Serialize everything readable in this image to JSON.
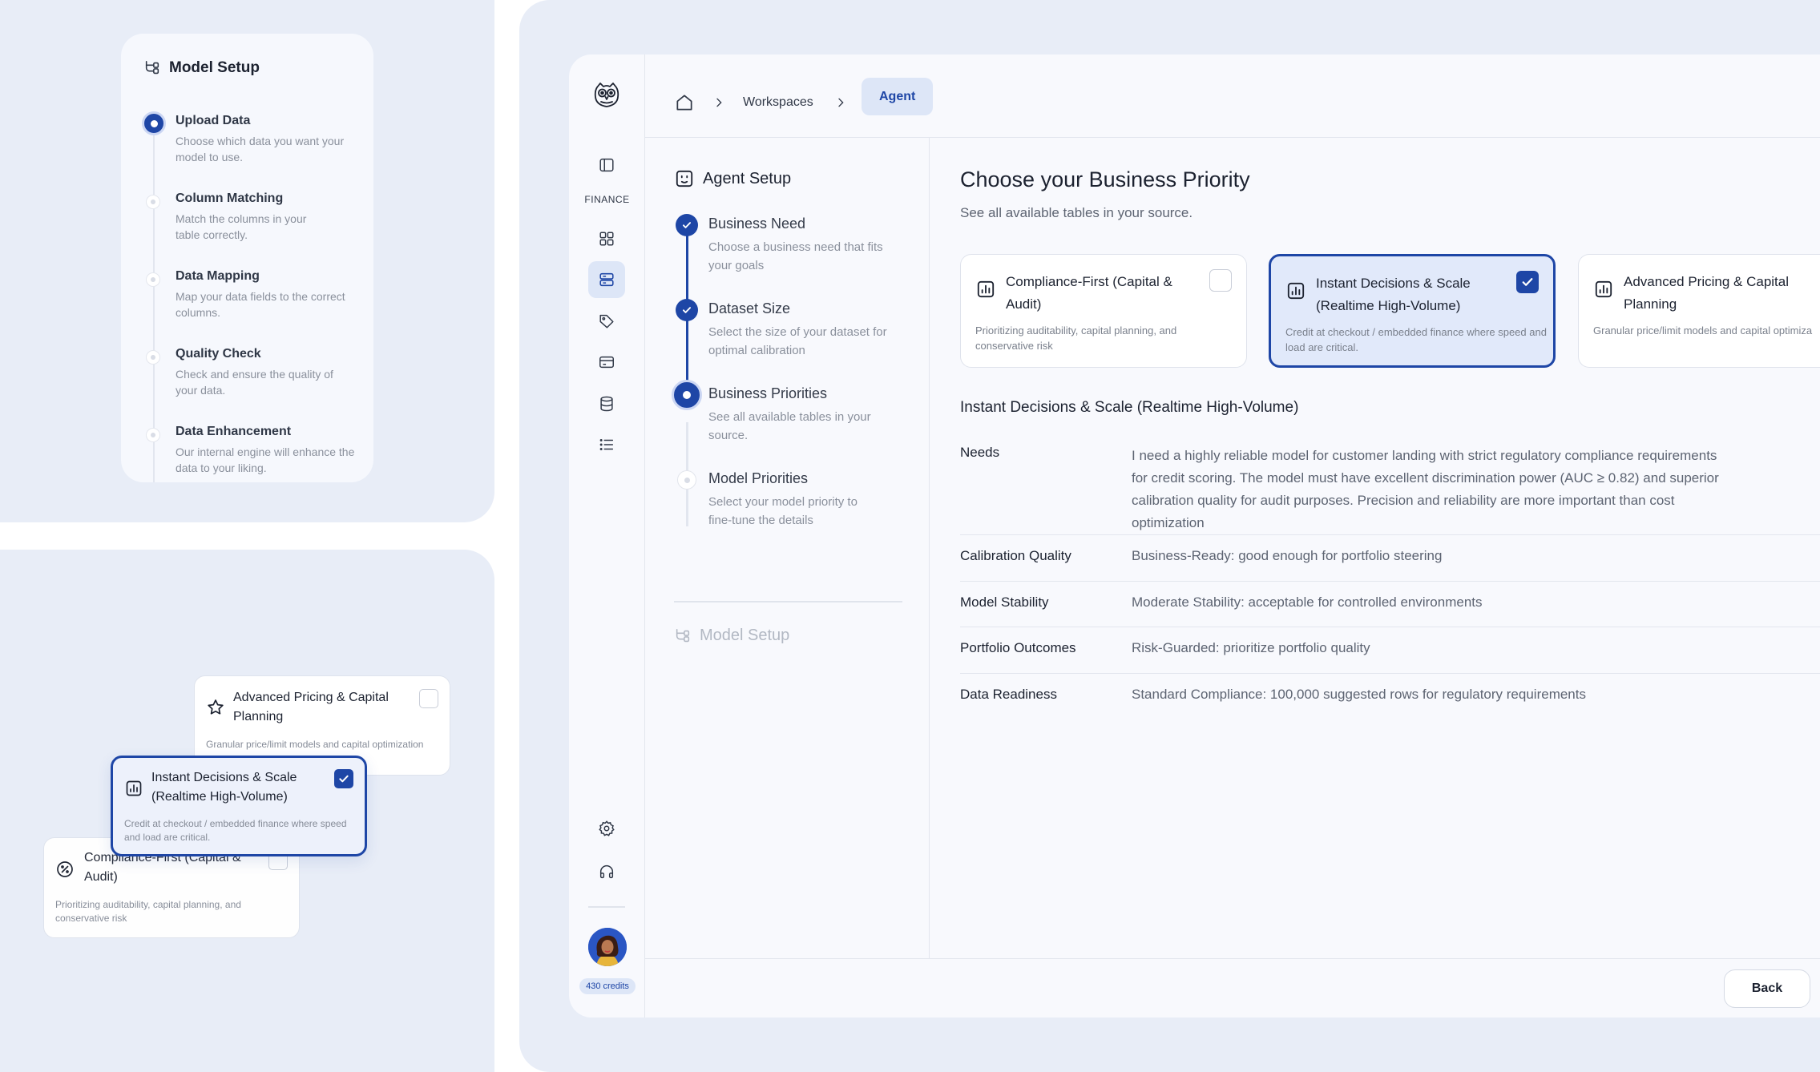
{
  "model_setup_card": {
    "title": "Model Setup",
    "steps": [
      {
        "title": "Upload Data",
        "desc": "Choose which data you want your model to use.",
        "state": "active"
      },
      {
        "title": "Column Matching",
        "desc": "Match the columns in your table correctly.",
        "state": "pending"
      },
      {
        "title": "Data Mapping",
        "desc": "Map your data fields to the correct columns.",
        "state": "pending"
      },
      {
        "title": "Quality Check",
        "desc": "Check and ensure the quality of your data.",
        "state": "pending"
      },
      {
        "title": "Data Enhancement",
        "desc": "Our internal engine will enhance the data to your liking.",
        "state": "pending"
      }
    ]
  },
  "stacked_cards": {
    "advanced": {
      "title": "Advanced Pricing & Capital Planning",
      "desc": "Granular price/limit models and capital optimization",
      "icon": "star-icon",
      "checked": false
    },
    "instant": {
      "title": "Instant Decisions & Scale (Realtime High-Volume)",
      "desc": "Credit at checkout / embedded finance where speed and load are critical.",
      "icon": "bar-chart-icon",
      "checked": true
    },
    "compliance": {
      "title": "Compliance-First (Capital & Audit)",
      "desc": "Prioritizing auditability, capital planning, and conservative risk",
      "icon": "percent-icon",
      "checked": false
    }
  },
  "rail": {
    "section_label": "FINANCE",
    "credits": "430 credits",
    "icons": [
      "owl-logo-icon",
      "sidebar-toggle-icon",
      "grid-icon",
      "server-icon",
      "tag-icon",
      "card-icon",
      "database-icon",
      "list-icon",
      "settings-icon",
      "headset-icon"
    ]
  },
  "breadcrumb": {
    "home_icon": "home-icon",
    "items": [
      "Workspaces",
      "Agent"
    ]
  },
  "agent_setup": {
    "title": "Agent Setup",
    "steps": [
      {
        "title": "Business Need",
        "desc": "Choose a business need that fits your goals",
        "state": "done"
      },
      {
        "title": "Dataset Size",
        "desc": "Select the size of your dataset for optimal calibration",
        "state": "done"
      },
      {
        "title": "Business Priorities",
        "desc": "See all available tables in your source.",
        "state": "current"
      },
      {
        "title": "Model Priorities",
        "desc": "Select your model priority to fine-tune the details",
        "state": "pending"
      }
    ],
    "next_section": "Model Setup"
  },
  "main": {
    "heading": "Choose your Business Priority",
    "subheading": "See all available tables in your source.",
    "cards": [
      {
        "title": "Compliance-First (Capital & Audit)",
        "desc": "Prioritizing auditability, capital planning, and conservative risk",
        "checked": false
      },
      {
        "title": "Instant Decisions & Scale (Realtime High-Volume)",
        "desc": "Credit at checkout / embedded finance where speed and load are critical.",
        "checked": true
      },
      {
        "title": "Advanced Pricing & Capital Planning",
        "desc": "Granular price/limit models and capital optimiza",
        "checked": false
      }
    ],
    "detail_title": "Instant Decisions & Scale (Realtime High-Volume)",
    "details": [
      {
        "label": "Needs",
        "value": "I need a highly reliable model for customer landing with strict regulatory compliance requirements for credit scoring. The model must have excellent discrimination power (AUC ≥ 0.82) and superior calibration quality for audit purposes. Precision and reliability are more important than cost optimization"
      },
      {
        "label": "Calibration Quality",
        "value": "Business-Ready: good enough for portfolio steering"
      },
      {
        "label": "Model Stability",
        "value": "Moderate Stability: acceptable for controlled environments"
      },
      {
        "label": "Portfolio Outcomes",
        "value": "Risk-Guarded: prioritize portfolio quality"
      },
      {
        "label": "Data Readiness",
        "value": "Standard Compliance: 100,000 suggested rows for regulatory requirements"
      }
    ]
  },
  "footer": {
    "back_label": "Back"
  },
  "colors": {
    "accent": "#1e46a6",
    "accent_soft": "#dde6f7",
    "panel": "#e8edf7",
    "muted": "#8a909c"
  }
}
